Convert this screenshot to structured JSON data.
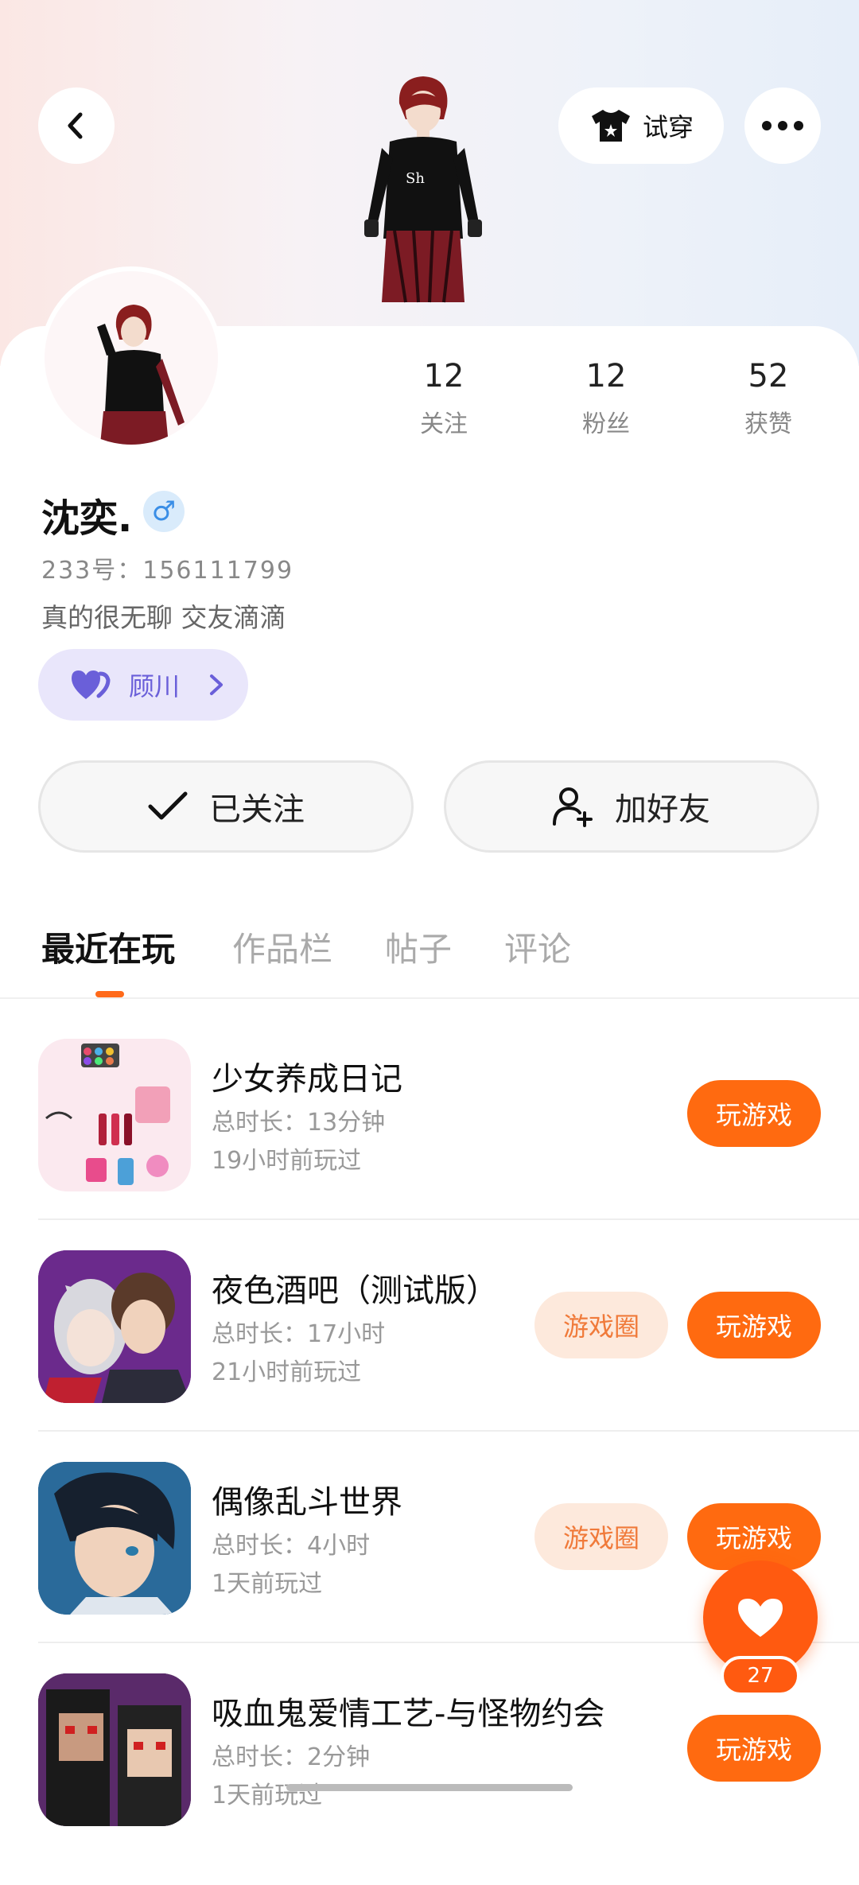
{
  "header": {
    "try_on_label": "试穿"
  },
  "profile": {
    "stats": [
      {
        "value": "12",
        "label": "关注"
      },
      {
        "value": "12",
        "label": "粉丝"
      },
      {
        "value": "52",
        "label": "获赞"
      }
    ],
    "name": "沈奕.",
    "gender_symbol": "♂",
    "id_line": "233号：156111799",
    "bio": "真的很无聊 交友滴滴",
    "cp_name": "顾川"
  },
  "actions": {
    "followed_label": "已关注",
    "add_friend_label": "加好友"
  },
  "tabs": [
    {
      "label": "最近在玩"
    },
    {
      "label": "作品栏"
    },
    {
      "label": "帖子"
    },
    {
      "label": "评论"
    }
  ],
  "games": [
    {
      "title": "少女养成日记",
      "duration": "总时长：13分钟",
      "last_played": "19小时前玩过",
      "has_circle": false
    },
    {
      "title": "夜色酒吧（测试版）",
      "duration": "总时长：17小时",
      "last_played": "21小时前玩过",
      "has_circle": true
    },
    {
      "title": "偶像乱斗世界",
      "duration": "总时长：4小时",
      "last_played": "1天前玩过",
      "has_circle": true
    },
    {
      "title": "吸血鬼爱情工艺-与怪物约会",
      "duration": "总时长：2分钟",
      "last_played": "1天前玩过",
      "has_circle": false
    }
  ],
  "buttons": {
    "play_label": "玩游戏",
    "circle_label": "游戏圈"
  },
  "like_fab": {
    "count": "27"
  },
  "colors": {
    "accent": "#ff6a10",
    "circle_bg": "#fde9dc",
    "cp_bg": "#e9e6fb"
  }
}
